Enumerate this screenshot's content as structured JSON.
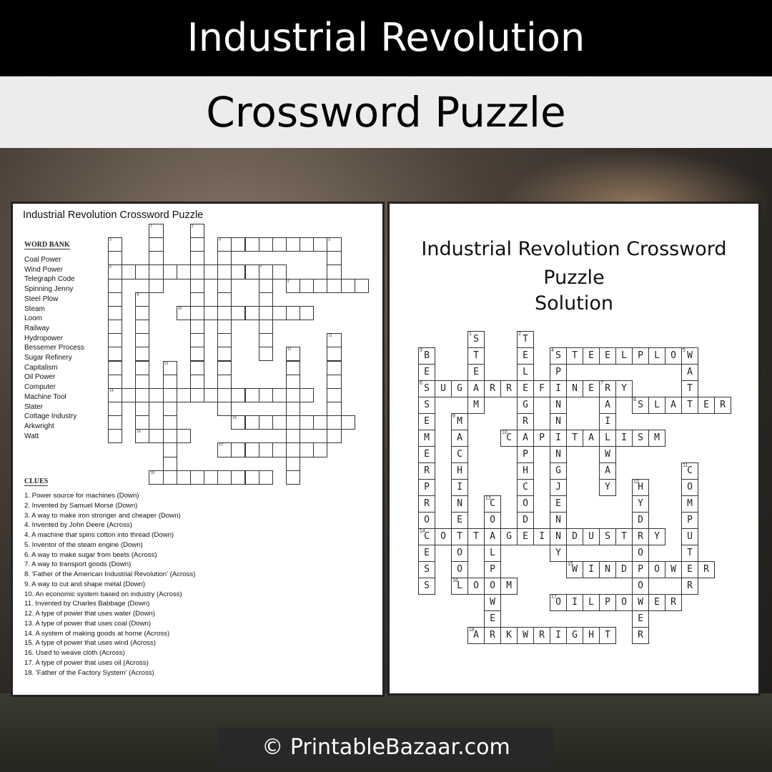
{
  "header": {
    "title": "Industrial Revolution",
    "subtitle": "Crossword Puzzle"
  },
  "puzzle": {
    "title": "Industrial Revolution Crossword Puzzle",
    "word_bank_heading": "WORD BANK",
    "word_bank": [
      "Coal Power",
      "Wind Power",
      "Telegraph Code",
      "Spinning Jenny",
      "Steel Plow",
      "Steam",
      "Loom",
      "Railway",
      "Hydropower",
      "Bessemer Process",
      "Sugar Refinery",
      "Capitalism",
      "Oil Power",
      "Computer",
      "Machine Tool",
      "Slater",
      "Cottage Industry",
      "Arkwright",
      "Watt"
    ],
    "clues_heading": "CLUES",
    "clues": [
      "1. Power source for machines (Down)",
      "2. Invented by Samuel Morse (Down)",
      "3. A way to make iron stronger and cheaper (Down)",
      "4. Invented by John Deere (Across)",
      "4. A machine that spins cotton into thread (Down)",
      "5. Inventor of the steam engine (Down)",
      "6. A way to make sugar from beets (Across)",
      "7. A way to transport goods (Down)",
      "8. 'Father of the American Industrial Revolution' (Across)",
      "9. A way to cut and shape metal (Down)",
      "10. An economic system based on industry (Across)",
      "11. Invented by Charles Babbage (Down)",
      "12. A type of power that uses water (Down)",
      "13. A type of power that uses coal (Down)",
      "14. A system of making goods at home (Across)",
      "15. A type of power that uses wind (Across)",
      "16. Used to weave cloth (Across)",
      "17. A type of power that uses oil (Across)",
      "18. 'Father of the Factory System' (Across)"
    ]
  },
  "solution": {
    "title": "Industrial Revolution Crossword Puzzle",
    "subtitle": "Solution",
    "answers": [
      {
        "number": 1,
        "direction": "Down",
        "answer": "STEAM"
      },
      {
        "number": 2,
        "direction": "Down",
        "answer": "TELEGRAPHCODE"
      },
      {
        "number": 3,
        "direction": "Down",
        "answer": "BESSEMERPROCESS"
      },
      {
        "number": 4,
        "direction": "Across",
        "answer": "STEELPLOW"
      },
      {
        "number": 4,
        "direction": "Down",
        "answer": "SPINNINGJENNY"
      },
      {
        "number": 5,
        "direction": "Down",
        "answer": "WATT"
      },
      {
        "number": 6,
        "direction": "Across",
        "answer": "SUGARREFINERY"
      },
      {
        "number": 7,
        "direction": "Down",
        "answer": "RAILWAY"
      },
      {
        "number": 8,
        "direction": "Across",
        "answer": "SLATER"
      },
      {
        "number": 9,
        "direction": "Down",
        "answer": "MACHINETOOL"
      },
      {
        "number": 10,
        "direction": "Across",
        "answer": "CAPITALISM"
      },
      {
        "number": 11,
        "direction": "Down",
        "answer": "COMPUTER"
      },
      {
        "number": 12,
        "direction": "Down",
        "answer": "HYDROPOWER"
      },
      {
        "number": 13,
        "direction": "Down",
        "answer": "COALPOWER"
      },
      {
        "number": 14,
        "direction": "Across",
        "answer": "COTTAGEINDUSTRY"
      },
      {
        "number": 15,
        "direction": "Across",
        "answer": "WINDPOWER"
      },
      {
        "number": 16,
        "direction": "Across",
        "answer": "LOOM"
      },
      {
        "number": 17,
        "direction": "Across",
        "answer": "OILPOWER"
      },
      {
        "number": 18,
        "direction": "Across",
        "answer": "ARKWRIGHT"
      }
    ]
  },
  "footer": {
    "copyright": "© PrintableBazaar.com"
  }
}
